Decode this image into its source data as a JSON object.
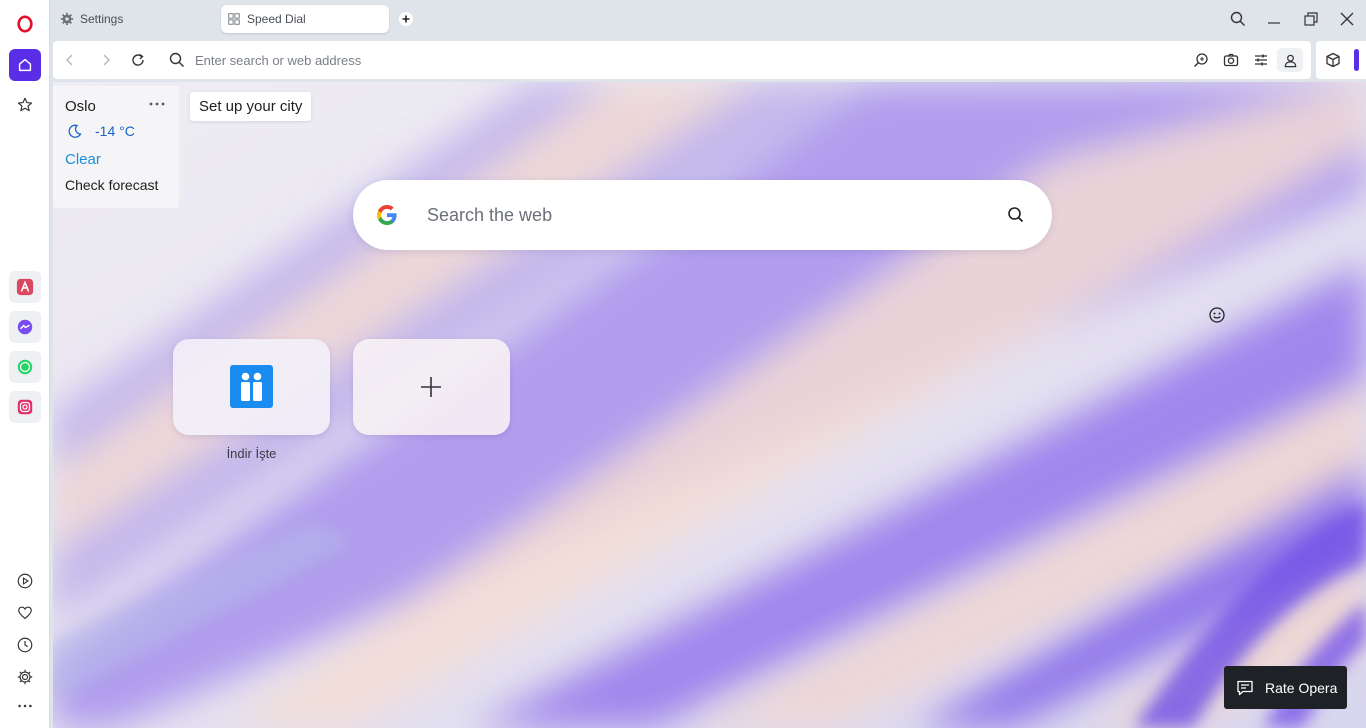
{
  "browser": {
    "logo_icon": "opera-logo-icon",
    "accent_color": "#5a2ee6"
  },
  "tabs": [
    {
      "label": "Settings",
      "icon": "gear-icon",
      "active": false
    },
    {
      "label": "Speed Dial",
      "icon": "grid-icon",
      "active": true
    }
  ],
  "address_bar": {
    "placeholder": "Enter search or web address"
  },
  "weather": {
    "city": "Oslo",
    "temperature": "-14 °C",
    "condition": "Clear",
    "forecast_link": "Check forecast",
    "setup_tip": "Set up your city"
  },
  "search": {
    "placeholder": "Search the web",
    "engine_icon": "google-logo-icon"
  },
  "speed_dial": [
    {
      "label": "İndir İşte",
      "icon": "indir-iste-logo-icon"
    },
    {
      "label": "",
      "icon": "plus-icon"
    }
  ],
  "rate_button": {
    "label": "Rate Opera"
  },
  "sidebar": {
    "top": [
      "home-icon",
      "star-icon"
    ],
    "apps": [
      "aria-icon",
      "messenger-icon",
      "whatsapp-icon",
      "instagram-icon"
    ],
    "bottom": [
      "player-icon",
      "heart-icon",
      "history-icon",
      "gear-icon",
      "more-icon"
    ]
  }
}
